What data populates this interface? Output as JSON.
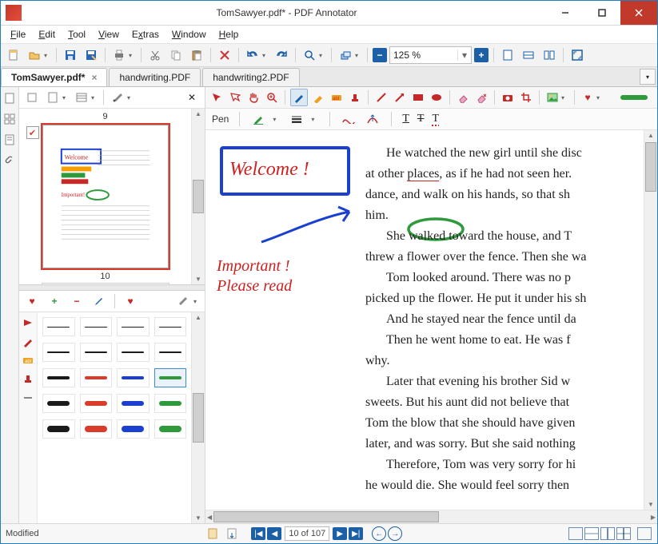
{
  "window": {
    "title": "TomSawyer.pdf* - PDF Annotator"
  },
  "menu": {
    "file": "File",
    "edit": "Edit",
    "tool": "Tool",
    "view": "View",
    "extras": "Extras",
    "window": "Window",
    "help": "Help"
  },
  "toolbar": {
    "zoom": "125 %"
  },
  "tabs": [
    {
      "label": "TomSawyer.pdf*",
      "active": true
    },
    {
      "label": "handwriting.PDF",
      "active": false
    },
    {
      "label": "handwriting2.PDF",
      "active": false
    }
  ],
  "sidebar": {
    "page_top": "9",
    "page_bottom": "10",
    "thumb_checked": true
  },
  "tool_options": {
    "label": "Pen"
  },
  "annotations": {
    "welcome": "Welcome !",
    "important_l1": "Important !",
    "important_l2": "Please read"
  },
  "document": {
    "p1": "He watched the new girl until she disc",
    "p2a": "at other ",
    "p2b": "places",
    "p2c": ", as if he had not seen her.",
    "p3": "dance, and walk on his hands, so that sh",
    "p4": "him.",
    "p5a": "She ",
    "p5b": "walked",
    "p5c": " toward the house, and T",
    "p6": "threw a flower over the fence. Then she wa",
    "p7": "Tom looked around. There was no p",
    "p8": "picked up the flower. He put it under his sh",
    "p9": "And he stayed near the fence until da",
    "p10": "Then he went home to eat. He was f",
    "p11": "why.",
    "p12": "Later that evening his brother Sid w",
    "p13": "sweets. But his aunt did not believe that",
    "p14": "Tom the blow that she should have given",
    "p15": "later, and was sorry. But she said nothing",
    "p16": "Therefore, Tom was very sorry for hi",
    "p17": "he would die. She would feel sorry then"
  },
  "status": {
    "left": "Modified",
    "page_field": "10",
    "page_total": "of 107"
  },
  "colors": {
    "red": "#d93c2b",
    "blue": "#1b3fd1",
    "green": "#2e9a3b",
    "black": "#1a1a1a",
    "accent": "#1b5fa6"
  }
}
